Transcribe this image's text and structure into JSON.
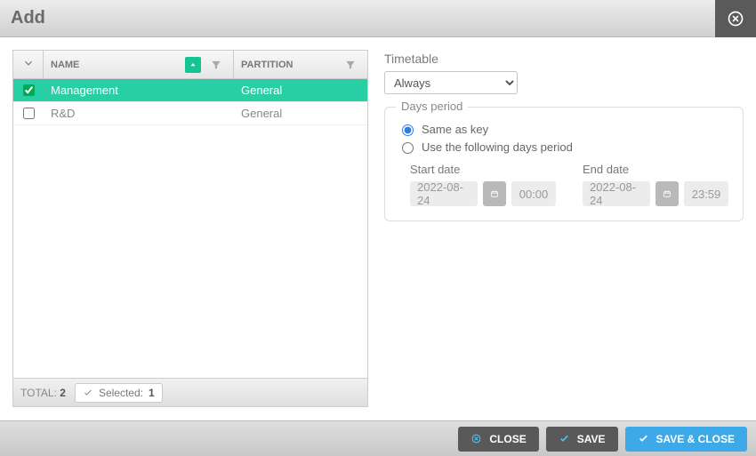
{
  "dialog": {
    "title": "Add"
  },
  "grid": {
    "columns": {
      "name": "NAME",
      "partition": "PARTITION"
    },
    "rows": [
      {
        "name": "Management",
        "partition": "General",
        "selected": true
      },
      {
        "name": "R&D",
        "partition": "General",
        "selected": false
      }
    ],
    "footer": {
      "total_label": "TOTAL:",
      "total_value": "2",
      "selected_label": "Selected:",
      "selected_value": "1"
    }
  },
  "timetable": {
    "title": "Timetable",
    "value": "Always"
  },
  "days_period": {
    "legend": "Days period",
    "opt_same": "Same as key",
    "opt_custom": "Use the following days period",
    "start_label": "Start date",
    "end_label": "End date",
    "start_date": "2022-08-24",
    "start_time": "00:00",
    "end_date": "2022-08-24",
    "end_time": "23:59"
  },
  "buttons": {
    "close": "CLOSE",
    "save": "SAVE",
    "save_close": "SAVE & CLOSE"
  }
}
